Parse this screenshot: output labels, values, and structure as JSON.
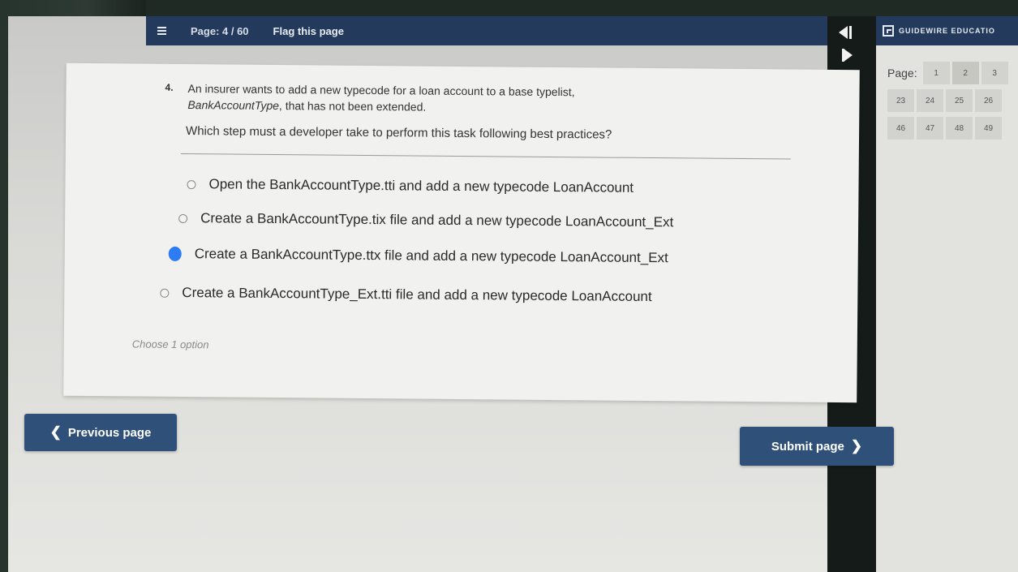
{
  "header": {
    "page_indicator": "Page: 4 / 60",
    "flag_label": "Flag this page"
  },
  "right_panel": {
    "brand": "GUIDEWIRE EDUCATIO",
    "page_label": "Page:",
    "rows": [
      [
        "1",
        "2",
        "3"
      ],
      [
        "23",
        "24",
        "25",
        "26"
      ],
      [
        "46",
        "47",
        "48",
        "49"
      ]
    ]
  },
  "question": {
    "number": "4.",
    "text_line1": "An insurer wants to add a new typecode for a loan account to a base typelist,",
    "text_line2_italic": "BankAccountType",
    "text_line2_rest": ", that has not been extended.",
    "prompt": "Which step must a developer take to perform this task following best practices?",
    "options": [
      {
        "label": "Open the BankAccountType.tti and add a new typecode LoanAccount",
        "selected": false
      },
      {
        "label": "Create a BankAccountType.tix file and add a new typecode LoanAccount_Ext",
        "selected": false
      },
      {
        "label": "Create a BankAccountType.ttx file and add a new typecode LoanAccount_Ext",
        "selected": true
      },
      {
        "label": "Create a BankAccountType_Ext.tti file and add a new typecode LoanAccount",
        "selected": false
      }
    ],
    "hint": "Choose 1 option"
  },
  "footer": {
    "prev_label": "Previous page",
    "submit_label": "Submit page"
  },
  "colors": {
    "header_bg": "#243a5c",
    "button_bg": "#2f5078",
    "selected_radio": "#2d7cf3"
  }
}
